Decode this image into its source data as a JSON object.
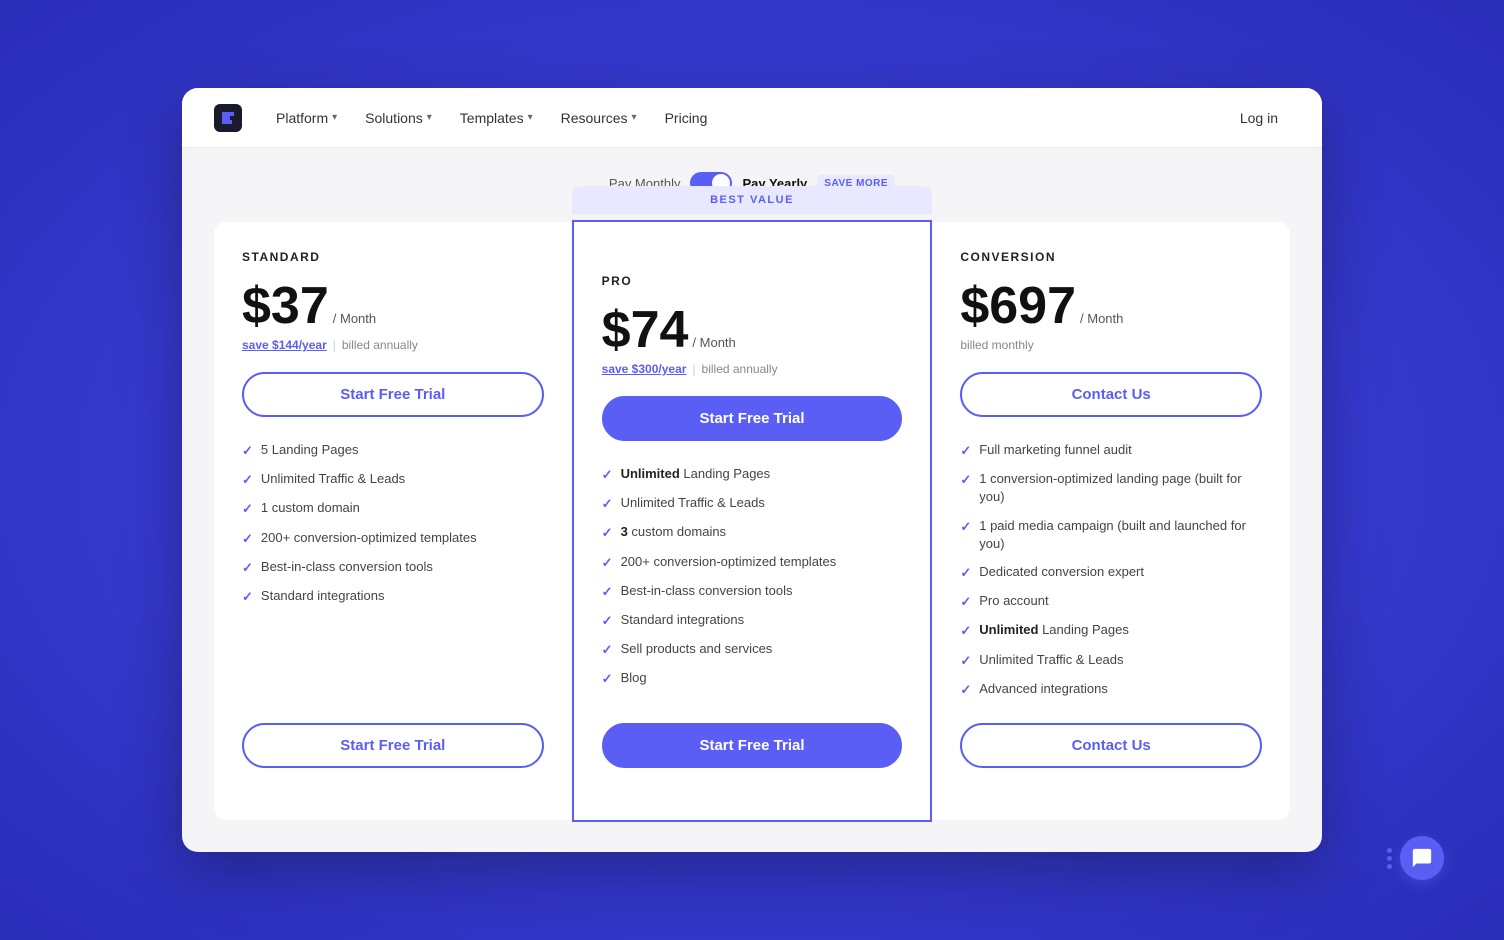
{
  "app": {
    "window_bg": "#4a4ef0"
  },
  "navbar": {
    "logo_alt": "Unbounce logo",
    "links": [
      {
        "label": "Platform",
        "has_dropdown": true
      },
      {
        "label": "Solutions",
        "has_dropdown": true
      },
      {
        "label": "Templates",
        "has_dropdown": true
      },
      {
        "label": "Resources",
        "has_dropdown": true
      },
      {
        "label": "Pricing",
        "has_dropdown": false
      }
    ],
    "login_label": "Log in"
  },
  "billing_toggle": {
    "monthly_label": "Pay Monthly",
    "yearly_label": "Pay Yearly",
    "save_badge": "SAVE MORE",
    "active": "yearly"
  },
  "plans": [
    {
      "id": "standard",
      "name": "STANDARD",
      "price": "$37",
      "period": "/ Month",
      "save_text": "save $144/year",
      "billing_note": "billed annually",
      "cta_top": "Start Free Trial",
      "cta_bottom": "Start Free Trial",
      "cta_style": "outline",
      "best_value": false,
      "features": [
        {
          "text": "5 Landing Pages",
          "bold_prefix": ""
        },
        {
          "text": "Unlimited Traffic & Leads",
          "bold_prefix": ""
        },
        {
          "text": "1 custom domain",
          "bold_prefix": ""
        },
        {
          "text": "200+ conversion-optimized templates",
          "bold_prefix": ""
        },
        {
          "text": "Best-in-class conversion tools",
          "bold_prefix": ""
        },
        {
          "text": "Standard integrations",
          "bold_prefix": ""
        }
      ]
    },
    {
      "id": "pro",
      "name": "PRO",
      "price": "$74",
      "period": "/ Month",
      "save_text": "save $300/year",
      "billing_note": "billed annually",
      "cta_top": "Start Free Trial",
      "cta_bottom": "Start Free Trial",
      "cta_style": "filled",
      "best_value": true,
      "best_value_label": "BEST VALUE",
      "features": [
        {
          "text": "Landing Pages",
          "bold_prefix": "Unlimited"
        },
        {
          "text": "Unlimited Traffic & Leads",
          "bold_prefix": ""
        },
        {
          "text": "custom domains",
          "bold_prefix": "3"
        },
        {
          "text": "200+ conversion-optimized templates",
          "bold_prefix": ""
        },
        {
          "text": "Best-in-class conversion tools",
          "bold_prefix": ""
        },
        {
          "text": "Standard integrations",
          "bold_prefix": ""
        },
        {
          "text": "Sell products and services",
          "bold_prefix": ""
        },
        {
          "text": "Blog",
          "bold_prefix": ""
        }
      ]
    },
    {
      "id": "conversion",
      "name": "CONVERSION",
      "price": "$697",
      "period": "/ Month",
      "save_text": "",
      "billing_note": "billed monthly",
      "cta_top": "Contact Us",
      "cta_bottom": "Contact Us",
      "cta_style": "outline",
      "best_value": false,
      "features": [
        {
          "text": "Full marketing funnel audit",
          "bold_prefix": ""
        },
        {
          "text": "1 conversion-optimized landing page (built for you)",
          "bold_prefix": ""
        },
        {
          "text": "1 paid media campaign (built and launched for you)",
          "bold_prefix": ""
        },
        {
          "text": "Dedicated conversion expert",
          "bold_prefix": ""
        },
        {
          "text": "Pro account",
          "bold_prefix": ""
        },
        {
          "text": "Landing Pages",
          "bold_prefix": "Unlimited"
        },
        {
          "text": "Unlimited Traffic & Leads",
          "bold_prefix": ""
        },
        {
          "text": "Advanced integrations",
          "bold_prefix": ""
        }
      ]
    }
  ],
  "chat": {
    "icon_alt": "chat support"
  }
}
